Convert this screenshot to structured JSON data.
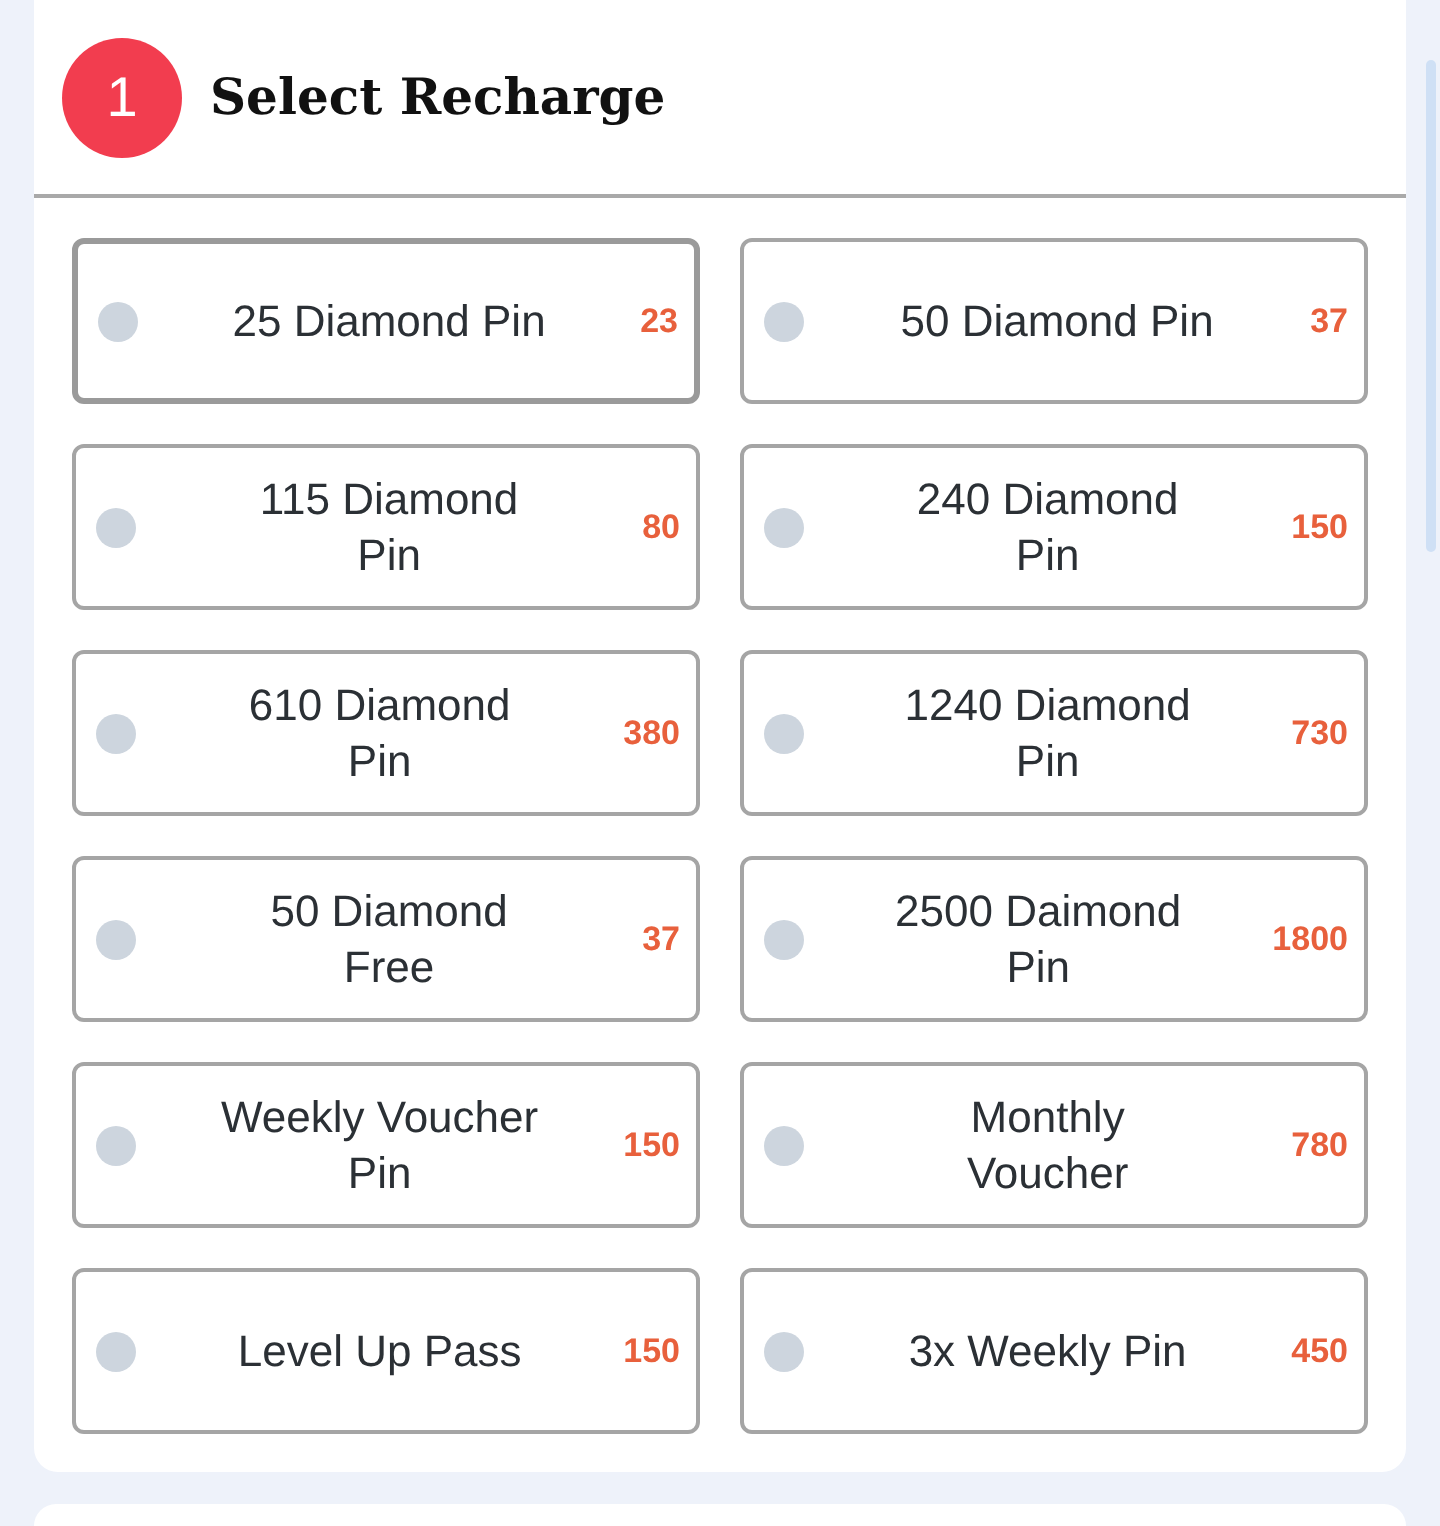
{
  "section": {
    "step": "1",
    "title": "Select Recharge"
  },
  "options": [
    {
      "label": "25 Diamond Pin",
      "price": "23",
      "selected": false,
      "focused": true
    },
    {
      "label": "50 Diamond Pin",
      "price": "37",
      "selected": false,
      "focused": false
    },
    {
      "label": "115 Diamond\nPin",
      "price": "80",
      "selected": false,
      "focused": false
    },
    {
      "label": "240 Diamond\nPin",
      "price": "150",
      "selected": false,
      "focused": false
    },
    {
      "label": "610 Diamond\nPin",
      "price": "380",
      "selected": false,
      "focused": false
    },
    {
      "label": "1240 Diamond\nPin",
      "price": "730",
      "selected": false,
      "focused": false
    },
    {
      "label": "50 Diamond\nFree",
      "price": "37",
      "selected": false,
      "focused": false
    },
    {
      "label": "2500 Daimond\nPin",
      "price": "1800",
      "selected": false,
      "focused": false
    },
    {
      "label": "Weekly Voucher\nPin",
      "price": "150",
      "selected": false,
      "focused": false
    },
    {
      "label": "Monthly\nVoucher",
      "price": "780",
      "selected": false,
      "focused": false
    },
    {
      "label": "Level Up Pass",
      "price": "150",
      "selected": false,
      "focused": false
    },
    {
      "label": "3x Weekly Pin",
      "price": "450",
      "selected": false,
      "focused": false
    }
  ]
}
